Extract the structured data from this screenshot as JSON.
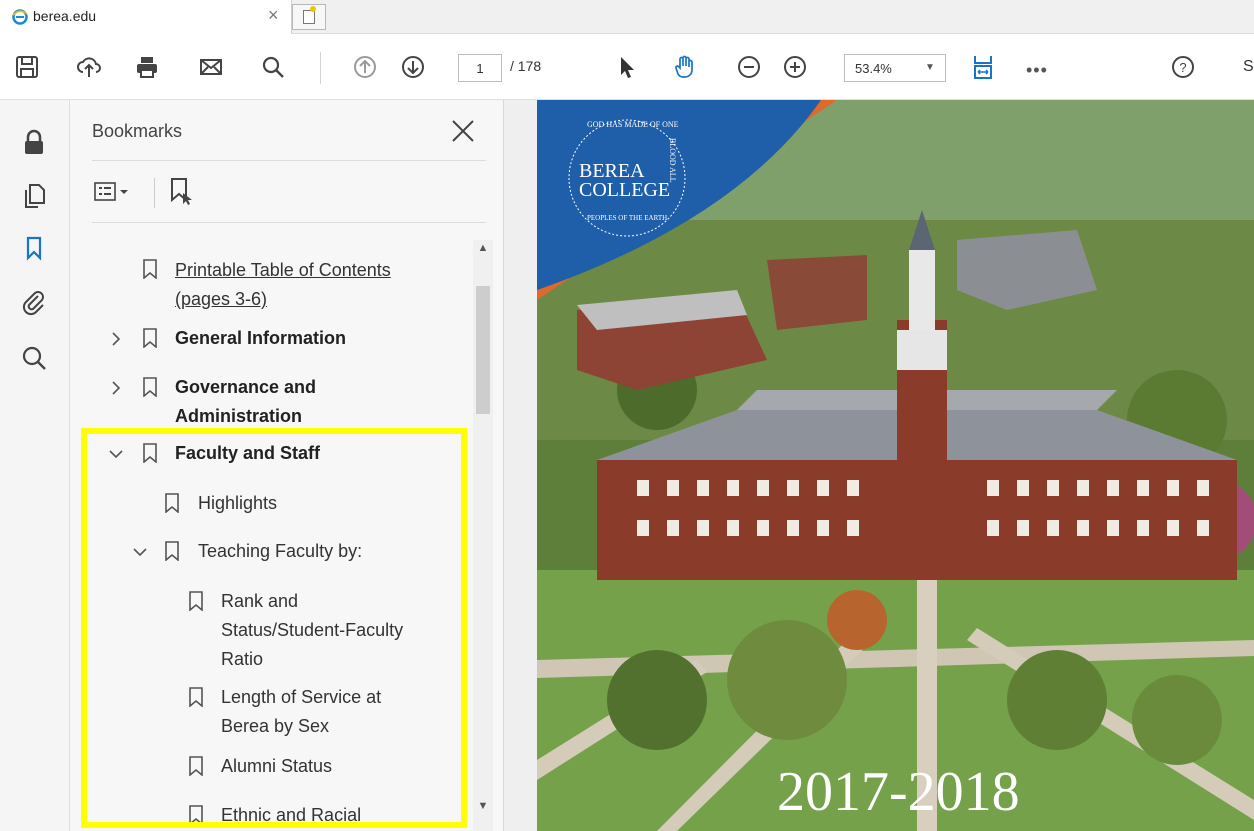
{
  "browser": {
    "tab_title": "berea.edu",
    "tab_close": "×"
  },
  "toolbar": {
    "page_current": "1",
    "page_total": "/ 178",
    "zoom": "53.4%",
    "more": "•••",
    "sign_label": "S",
    "icons": [
      "save-icon",
      "cloud-upload-icon",
      "print-icon",
      "mail-icon",
      "search-icon",
      "page-up-icon",
      "page-down-icon",
      "select-arrow-icon",
      "hand-tool-icon",
      "zoom-out-icon",
      "zoom-in-icon",
      "fit-page-icon",
      "help-icon"
    ]
  },
  "rail": {
    "icons": [
      "lock-icon",
      "copy-pages-icon",
      "bookmark-icon",
      "attachment-icon",
      "search-icon"
    ]
  },
  "bookmarks": {
    "title": "Bookmarks",
    "items": [
      {
        "label_line1": "Printable Table of Contents",
        "label_line2": "(pages 3-6)",
        "style": "link",
        "chevron": "none"
      },
      {
        "label": "General Information",
        "style": "bold",
        "chevron": "right"
      },
      {
        "label_line1": "Governance and",
        "label_line2": "Administration",
        "style": "bold",
        "chevron": "right"
      },
      {
        "label": "Faculty and Staff",
        "style": "bold",
        "chevron": "down"
      },
      {
        "label": "Highlights",
        "style": "normal",
        "chevron": "none"
      },
      {
        "label": "Teaching Faculty by:",
        "style": "normal",
        "chevron": "down"
      },
      {
        "label_line1": "Rank and",
        "label_line2": "Status/Student-Faculty",
        "label_line3": "Ratio",
        "style": "normal",
        "chevron": "none"
      },
      {
        "label_line1": "Length of Service at",
        "label_line2": "Berea by Sex",
        "style": "normal",
        "chevron": "none"
      },
      {
        "label": "Alumni Status",
        "style": "normal",
        "chevron": "none"
      },
      {
        "label": "Ethnic and Racial",
        "style": "normal",
        "chevron": "none"
      }
    ]
  },
  "document": {
    "logo_line1": "BEREA",
    "logo_line2": "COLLEGE",
    "seal_top": "GOD HAS MADE OF ONE",
    "seal_side": "BLOOD ALL",
    "seal_bottom": "PEOPLES OF THE EARTH",
    "year": "2017-2018"
  },
  "colors": {
    "highlight": "#ffff00",
    "logo_blue": "#1f5ea8",
    "accent_orange": "#e0682a",
    "grass": "#6f9a3c",
    "brick": "#8a3a2a",
    "roof": "#8e939b"
  }
}
